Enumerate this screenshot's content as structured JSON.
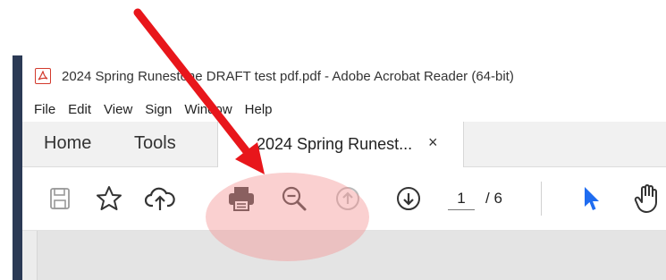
{
  "caption": "",
  "window": {
    "title": "2024 Spring Runestone DRAFT test pdf.pdf - Adobe Acrobat Reader (64-bit)"
  },
  "menu": [
    "File",
    "Edit",
    "View",
    "Sign",
    "Window",
    "Help"
  ],
  "tabs": {
    "home": "Home",
    "tools": "Tools",
    "document": "2024 Spring Runest...",
    "close": "×"
  },
  "toolbar": {
    "icons": [
      "save-icon",
      "bookmark-star-icon",
      "upload-cloud-icon",
      "print-icon",
      "zoom-out-icon",
      "page-up-icon",
      "page-down-icon",
      "select-arrow-icon",
      "hand-tool-icon"
    ],
    "page_current": "1",
    "page_total": "/ 6"
  },
  "colors": {
    "annotation_arrow": "#e8161b",
    "annotation_highlight": "#f49696",
    "select_tool": "#1f6cf0",
    "left_strip": "#2b3a55"
  }
}
